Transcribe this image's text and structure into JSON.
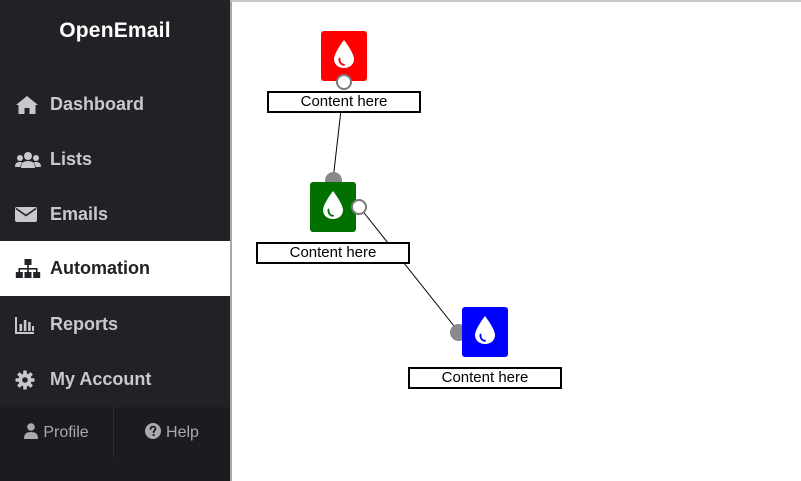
{
  "app": {
    "title": "OpenEmail"
  },
  "sidebar": {
    "items": [
      {
        "label": "Dashboard",
        "icon": "home-icon",
        "active": false
      },
      {
        "label": "Lists",
        "icon": "users-icon",
        "active": false
      },
      {
        "label": "Emails",
        "icon": "envelope-icon",
        "active": false
      },
      {
        "label": "Automation",
        "icon": "sitemap-icon",
        "active": true
      },
      {
        "label": "Reports",
        "icon": "bar-chart-icon",
        "active": false
      },
      {
        "label": "My Account",
        "icon": "gear-icon",
        "active": false
      }
    ],
    "footer": {
      "profile_label": "Profile",
      "help_label": "Help"
    }
  },
  "canvas": {
    "nodes": [
      {
        "label": "Content here",
        "color": "#ff0000",
        "icon": "drop-icon"
      },
      {
        "label": "Content here",
        "color": "#007000",
        "icon": "drop-icon"
      },
      {
        "label": "Content here",
        "color": "#0000ff",
        "icon": "drop-icon"
      }
    ]
  },
  "colors": {
    "sidebar_bg": "#212226",
    "footer_bg": "#1b1c1f",
    "active_bg": "#ffffff",
    "port_in": "#8a8a8a"
  }
}
